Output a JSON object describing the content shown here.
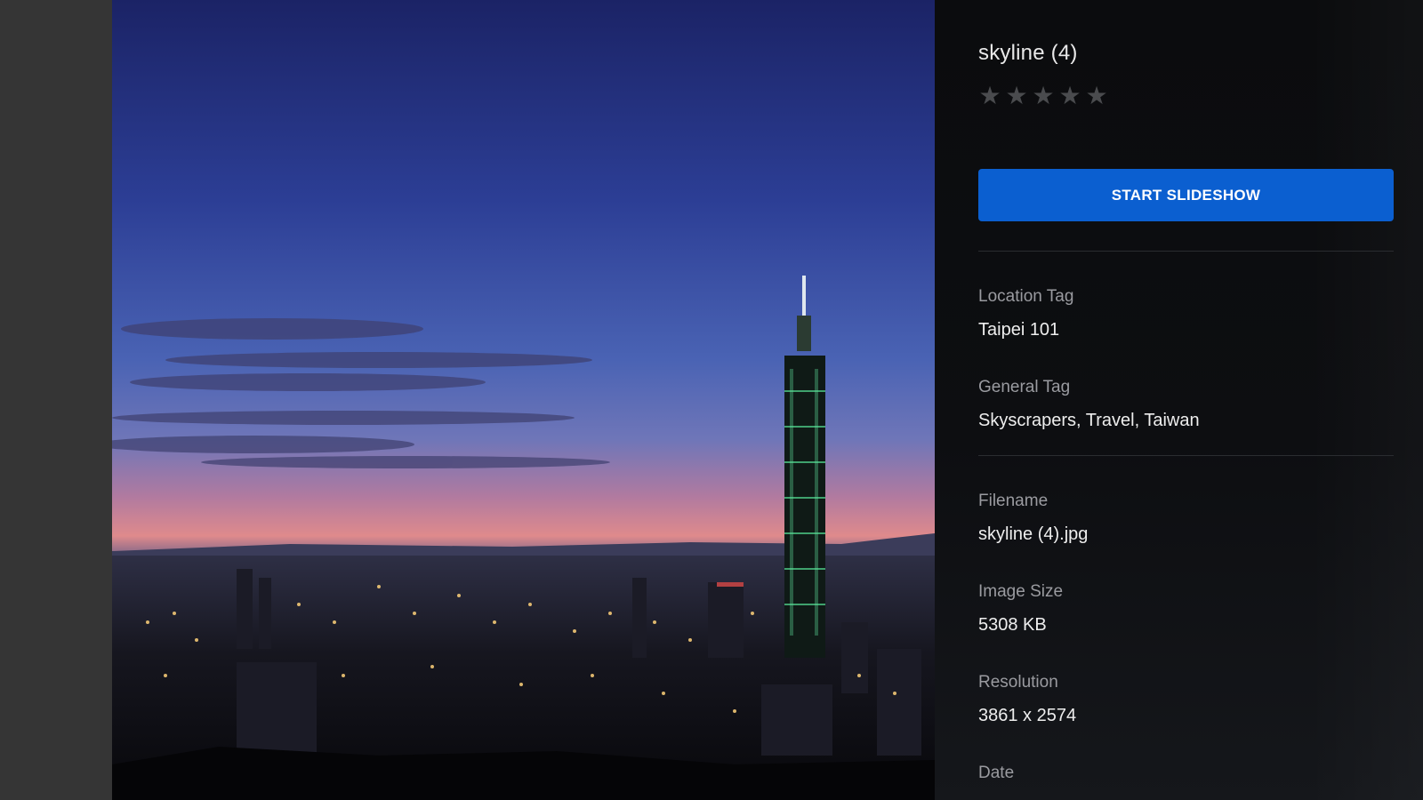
{
  "photo": {
    "title": "skyline (4)",
    "rating": 0,
    "max_rating": 5
  },
  "actions": {
    "slideshow_label": "START SLIDESHOW"
  },
  "tags": {
    "location_label": "Location Tag",
    "location_value": "Taipei 101",
    "general_label": "General Tag",
    "general_value": "Skyscrapers, Travel, Taiwan"
  },
  "details": {
    "filename_label": "Filename",
    "filename_value": "skyline (4).jpg",
    "size_label": "Image Size",
    "size_value": "5308 KB",
    "resolution_label": "Resolution",
    "resolution_value": "3861 x 2574",
    "date_label": "Date"
  },
  "colors": {
    "accent": "#0b5fd0",
    "panel_bg": "#0d0e11",
    "gutter_bg": "#353535"
  },
  "icons": {
    "star": "star-icon"
  }
}
